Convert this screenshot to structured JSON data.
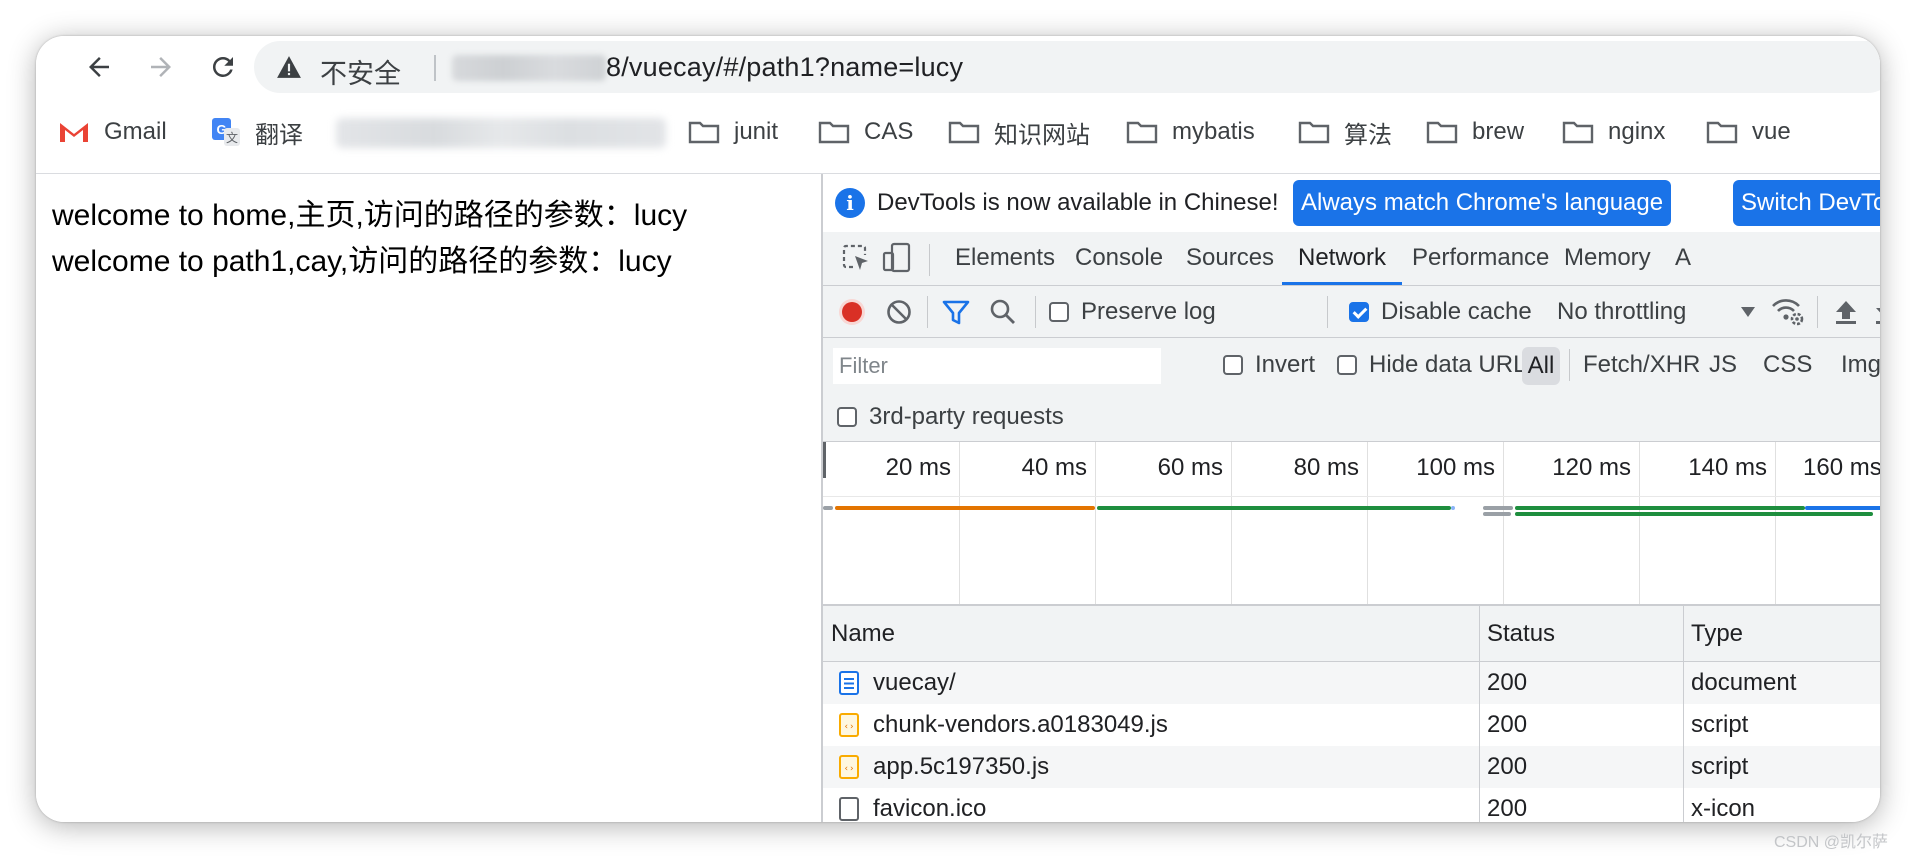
{
  "browser": {
    "security_label": "不安全",
    "url_visible": "8/vuecay/#/path1?name=lucy"
  },
  "bookmarks": [
    {
      "label": "Gmail",
      "icon": "gmail-icon"
    },
    {
      "label": "翻译",
      "icon": "translate-icon"
    },
    {
      "label": "junit",
      "icon": "folder-icon"
    },
    {
      "label": "CAS",
      "icon": "folder-icon"
    },
    {
      "label": "知识网站",
      "icon": "folder-icon"
    },
    {
      "label": "mybatis",
      "icon": "folder-icon"
    },
    {
      "label": "算法",
      "icon": "folder-icon"
    },
    {
      "label": "brew",
      "icon": "folder-icon"
    },
    {
      "label": "nginx",
      "icon": "folder-icon"
    },
    {
      "label": "vue",
      "icon": "folder-icon"
    }
  ],
  "page": {
    "line1": "welcome to home,主页,访问的路径的参数：lucy",
    "line2": "welcome to path1,cay,访问的路径的参数：lucy"
  },
  "devtools": {
    "info_text": "DevTools is now available in Chinese!",
    "btn_match": "Always match Chrome's language",
    "btn_switch": "Switch DevTools",
    "tabs": [
      "Elements",
      "Console",
      "Sources",
      "Network",
      "Performance",
      "Memory",
      "A"
    ],
    "active_tab": "Network",
    "toolbar": {
      "preserve_log": "Preserve log",
      "disable_cache": "Disable cache",
      "throttling": "No throttling"
    },
    "filter": {
      "placeholder": "Filter",
      "invert": "Invert",
      "hide_data_urls": "Hide data URLs",
      "types": [
        "All",
        "Fetch/XHR",
        "JS",
        "CSS",
        "Img"
      ],
      "third_party": "3rd-party requests"
    },
    "timeline_ticks": [
      "20 ms",
      "40 ms",
      "60 ms",
      "80 ms",
      "100 ms",
      "120 ms",
      "140 ms",
      "160 ms"
    ],
    "table": {
      "headers": [
        "Name",
        "Status",
        "Type"
      ],
      "rows": [
        {
          "name": "vuecay/",
          "status": "200",
          "type": "document",
          "icon": "document-icon"
        },
        {
          "name": "chunk-vendors.a0183049.js",
          "status": "200",
          "type": "script",
          "icon": "script-icon"
        },
        {
          "name": "app.5c197350.js",
          "status": "200",
          "type": "script",
          "icon": "script-icon"
        },
        {
          "name": "favicon.ico",
          "status": "200",
          "type": "x-icon",
          "icon": "file-icon"
        }
      ]
    }
  },
  "colors": {
    "accent": "#1a73e8",
    "record": "#d93025",
    "bar_orange": "#e37400",
    "bar_green": "#1e8e3e",
    "bar_blue": "#1a73e8"
  },
  "watermark": "CSDN @凯尔萨"
}
